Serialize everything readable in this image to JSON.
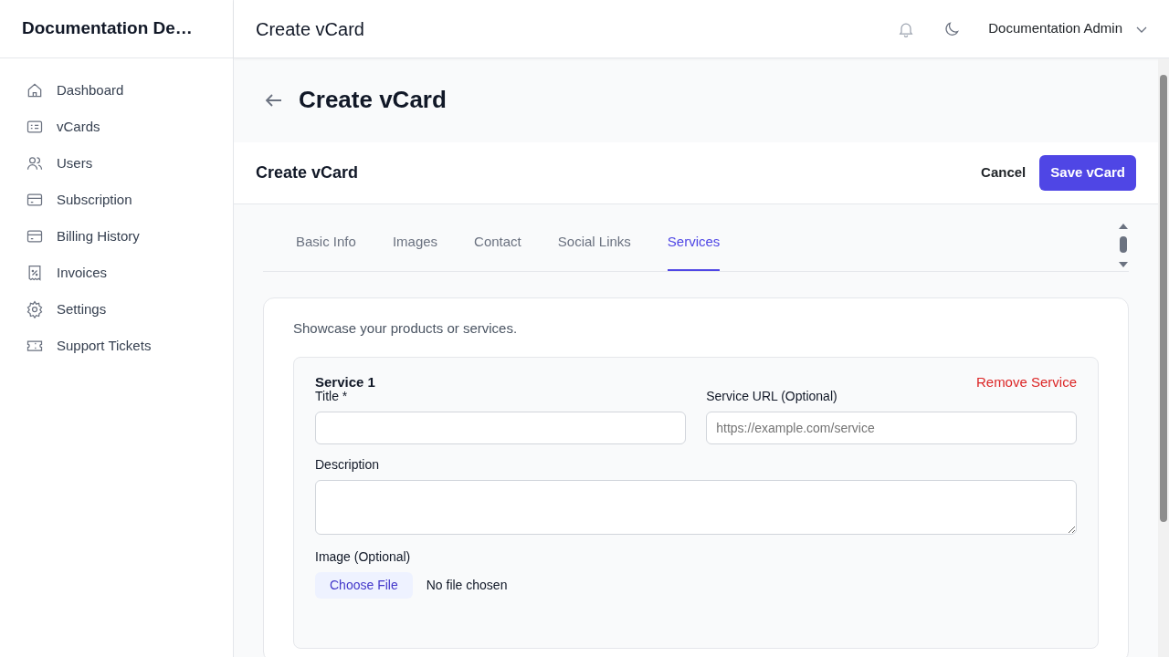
{
  "sidebar": {
    "brand": "Documentation De…",
    "items": [
      {
        "label": "Dashboard",
        "selected": false
      },
      {
        "label": "vCards",
        "selected": false
      },
      {
        "label": "Users",
        "selected": false
      },
      {
        "label": "Subscription",
        "selected": false
      },
      {
        "label": "Billing History",
        "selected": false
      },
      {
        "label": "Invoices",
        "selected": false
      },
      {
        "label": "Settings",
        "selected": false
      },
      {
        "label": "Support Tickets",
        "selected": false
      }
    ]
  },
  "header": {
    "title": "Create vCard",
    "user": "Documentation Admin"
  },
  "page": {
    "title": "Create vCard"
  },
  "card": {
    "title": "Create vCard",
    "cancel": "Cancel",
    "save": "Save vCard",
    "tabs": [
      {
        "label": "Basic Info",
        "selected": false
      },
      {
        "label": "Images",
        "selected": false
      },
      {
        "label": "Contact",
        "selected": false
      },
      {
        "label": "Social Links",
        "selected": false
      },
      {
        "label": "Services",
        "selected": true
      }
    ],
    "intro": "Showcase your products or services.",
    "service": {
      "heading": "Service 1",
      "remove": "Remove Service",
      "fields": [
        {
          "label": "Title *",
          "kind": "input"
        },
        {
          "label": "Service URL (Optional)",
          "kind": "input",
          "placeholder": "https://example.com/service"
        },
        {
          "label": "Description",
          "kind": "textarea"
        }
      ],
      "image": {
        "label": "Image (Optional)",
        "button": "Choose File",
        "status": "No file chosen"
      }
    }
  }
}
